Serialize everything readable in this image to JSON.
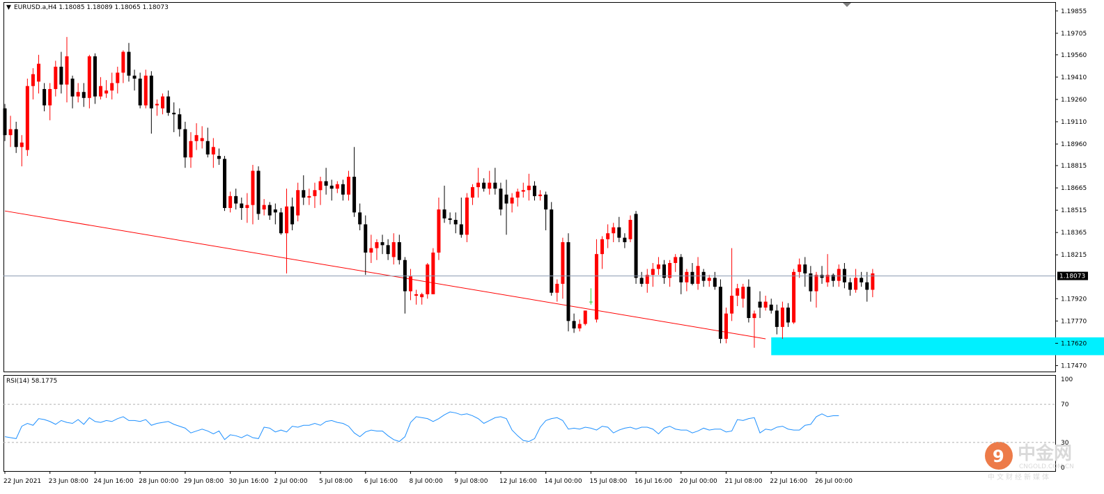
{
  "header": {
    "symbol_line": "EURUSD.a,H4  1.18085 1.18089 1.18065 1.18073",
    "arrow": "▼"
  },
  "colors": {
    "bull": "#ff0000",
    "bear": "#000000",
    "neutral": "#33cc33",
    "rsi_line": "#1e90ff",
    "trendline": "#ff0000",
    "support_zone": "#00f0ff",
    "price_line": "#8a9ab0"
  },
  "rsi": {
    "label": "RSI(14) 58.1775",
    "axis_labels": [
      "100",
      "70",
      "30",
      "0"
    ]
  },
  "watermark": {
    "cn": "中金网",
    "en": "CNGOLD.COM.CN",
    "sub": "中文财经新媒体"
  },
  "chart_data": {
    "type": "candlestick",
    "symbol": "EURUSD.a",
    "timeframe": "H4",
    "last_price": 1.18073,
    "price_axis": {
      "ylim": [
        1.1743,
        1.1991
      ],
      "ticks": [
        "1.19855",
        "1.19705",
        "1.19560",
        "1.19410",
        "1.19260",
        "1.19110",
        "1.18960",
        "1.18815",
        "1.18665",
        "1.18515",
        "1.18365",
        "1.18215",
        "1.18073",
        "1.17920",
        "1.17770",
        "1.17620",
        "1.17470"
      ],
      "current_price_label": "1.18073"
    },
    "time_axis": {
      "labels": [
        "22 Jun 2021",
        "23 Jun 08:00",
        "24 Jun 16:00",
        "28 Jun 00:00",
        "29 Jun 08:00",
        "30 Jun 16:00",
        "2 Jul 00:00",
        "5 Jul 08:00",
        "6 Jul 16:00",
        "8 Jul 00:00",
        "9 Jul 08:00",
        "12 Jul 16:00",
        "14 Jul 00:00",
        "15 Jul 08:00",
        "16 Jul 16:00",
        "20 Jul 00:00",
        "21 Jul 08:00",
        "22 Jul 16:00",
        "26 Jul 00:00"
      ],
      "label_bar_index": [
        0,
        8,
        16,
        24,
        32,
        40,
        48,
        56,
        64,
        72,
        80,
        88,
        96,
        104,
        112,
        120,
        128,
        136,
        144
      ]
    },
    "candles": [
      {
        "o": 1.192,
        "h": 1.1923,
        "l": 1.1898,
        "c": 1.1902
      },
      {
        "o": 1.1902,
        "h": 1.1915,
        "l": 1.1894,
        "c": 1.1906
      },
      {
        "o": 1.1906,
        "h": 1.1911,
        "l": 1.189,
        "c": 1.1894
      },
      {
        "o": 1.1894,
        "h": 1.1902,
        "l": 1.1881,
        "c": 1.1897
      },
      {
        "o": 1.1892,
        "h": 1.194,
        "l": 1.1888,
        "c": 1.1935
      },
      {
        "o": 1.1935,
        "h": 1.1947,
        "l": 1.1926,
        "c": 1.1943
      },
      {
        "o": 1.1938,
        "h": 1.1956,
        "l": 1.193,
        "c": 1.195
      },
      {
        "o": 1.1933,
        "h": 1.1937,
        "l": 1.1918,
        "c": 1.1922
      },
      {
        "o": 1.1922,
        "h": 1.1937,
        "l": 1.1912,
        "c": 1.1933
      },
      {
        "o": 1.1933,
        "h": 1.1952,
        "l": 1.1928,
        "c": 1.1948
      },
      {
        "o": 1.1948,
        "h": 1.1958,
        "l": 1.193,
        "c": 1.1936
      },
      {
        "o": 1.1936,
        "h": 1.1968,
        "l": 1.1924,
        "c": 1.1955
      },
      {
        "o": 1.194,
        "h": 1.1942,
        "l": 1.192,
        "c": 1.1928
      },
      {
        "o": 1.1928,
        "h": 1.1937,
        "l": 1.1924,
        "c": 1.1931
      },
      {
        "o": 1.1931,
        "h": 1.1937,
        "l": 1.1921,
        "c": 1.1927
      },
      {
        "o": 1.1927,
        "h": 1.1956,
        "l": 1.192,
        "c": 1.1955
      },
      {
        "o": 1.1955,
        "h": 1.1957,
        "l": 1.1923,
        "c": 1.1928
      },
      {
        "o": 1.1928,
        "h": 1.1941,
        "l": 1.1926,
        "c": 1.1935
      },
      {
        "o": 1.193,
        "h": 1.1939,
        "l": 1.1927,
        "c": 1.1932
      },
      {
        "o": 1.1932,
        "h": 1.1944,
        "l": 1.1926,
        "c": 1.1937
      },
      {
        "o": 1.1937,
        "h": 1.1948,
        "l": 1.193,
        "c": 1.1944
      },
      {
        "o": 1.1944,
        "h": 1.1959,
        "l": 1.1937,
        "c": 1.1958
      },
      {
        "o": 1.1958,
        "h": 1.1964,
        "l": 1.1938,
        "c": 1.1942
      },
      {
        "o": 1.1942,
        "h": 1.1946,
        "l": 1.1932,
        "c": 1.194
      },
      {
        "o": 1.194,
        "h": 1.1944,
        "l": 1.192,
        "c": 1.1922
      },
      {
        "o": 1.1922,
        "h": 1.1946,
        "l": 1.192,
        "c": 1.1942
      },
      {
        "o": 1.1942,
        "h": 1.1945,
        "l": 1.1903,
        "c": 1.192
      },
      {
        "o": 1.1922,
        "h": 1.1926,
        "l": 1.1915,
        "c": 1.1923
      },
      {
        "o": 1.192,
        "h": 1.193,
        "l": 1.1916,
        "c": 1.1928
      },
      {
        "o": 1.1928,
        "h": 1.1932,
        "l": 1.1915,
        "c": 1.1917
      },
      {
        "o": 1.1917,
        "h": 1.1924,
        "l": 1.1904,
        "c": 1.1916
      },
      {
        "o": 1.1916,
        "h": 1.192,
        "l": 1.1901,
        "c": 1.1906
      },
      {
        "o": 1.1906,
        "h": 1.1911,
        "l": 1.188,
        "c": 1.1887
      },
      {
        "o": 1.1887,
        "h": 1.1904,
        "l": 1.188,
        "c": 1.1898
      },
      {
        "o": 1.1898,
        "h": 1.191,
        "l": 1.1892,
        "c": 1.1902
      },
      {
        "o": 1.1898,
        "h": 1.1908,
        "l": 1.1893,
        "c": 1.19
      },
      {
        "o": 1.1898,
        "h": 1.1907,
        "l": 1.1887,
        "c": 1.1889
      },
      {
        "o": 1.1889,
        "h": 1.19,
        "l": 1.188,
        "c": 1.1894
      },
      {
        "o": 1.1888,
        "h": 1.1893,
        "l": 1.1882,
        "c": 1.1886
      },
      {
        "o": 1.1886,
        "h": 1.1888,
        "l": 1.1851,
        "c": 1.1853
      },
      {
        "o": 1.1853,
        "h": 1.1864,
        "l": 1.185,
        "c": 1.1861
      },
      {
        "o": 1.1861,
        "h": 1.1866,
        "l": 1.1852,
        "c": 1.1856
      },
      {
        "o": 1.1856,
        "h": 1.186,
        "l": 1.1845,
        "c": 1.1853
      },
      {
        "o": 1.1853,
        "h": 1.1863,
        "l": 1.1843,
        "c": 1.1855
      },
      {
        "o": 1.1855,
        "h": 1.1882,
        "l": 1.1842,
        "c": 1.1878
      },
      {
        "o": 1.1878,
        "h": 1.1881,
        "l": 1.1845,
        "c": 1.1849
      },
      {
        "o": 1.1852,
        "h": 1.1859,
        "l": 1.1848,
        "c": 1.1855
      },
      {
        "o": 1.1855,
        "h": 1.1857,
        "l": 1.1845,
        "c": 1.1848
      },
      {
        "o": 1.1852,
        "h": 1.1856,
        "l": 1.1842,
        "c": 1.185
      },
      {
        "o": 1.185,
        "h": 1.1853,
        "l": 1.1835,
        "c": 1.1836
      },
      {
        "o": 1.1836,
        "h": 1.1866,
        "l": 1.1809,
        "c": 1.1854
      },
      {
        "o": 1.1854,
        "h": 1.186,
        "l": 1.1838,
        "c": 1.1842
      },
      {
        "o": 1.1848,
        "h": 1.187,
        "l": 1.1844,
        "c": 1.1865
      },
      {
        "o": 1.1865,
        "h": 1.1875,
        "l": 1.1855,
        "c": 1.186
      },
      {
        "o": 1.186,
        "h": 1.1866,
        "l": 1.1855,
        "c": 1.1861
      },
      {
        "o": 1.1861,
        "h": 1.187,
        "l": 1.1853,
        "c": 1.1865
      },
      {
        "o": 1.1865,
        "h": 1.1874,
        "l": 1.1855,
        "c": 1.1871
      },
      {
        "o": 1.1871,
        "h": 1.188,
        "l": 1.1862,
        "c": 1.1868
      },
      {
        "o": 1.1868,
        "h": 1.1872,
        "l": 1.1858,
        "c": 1.1866
      },
      {
        "o": 1.1866,
        "h": 1.1871,
        "l": 1.1863,
        "c": 1.1869
      },
      {
        "o": 1.1869,
        "h": 1.1872,
        "l": 1.1858,
        "c": 1.1862
      },
      {
        "o": 1.1862,
        "h": 1.1878,
        "l": 1.1858,
        "c": 1.1874
      },
      {
        "o": 1.1874,
        "h": 1.1894,
        "l": 1.1847,
        "c": 1.185
      },
      {
        "o": 1.185,
        "h": 1.1856,
        "l": 1.1838,
        "c": 1.1842
      },
      {
        "o": 1.1842,
        "h": 1.1848,
        "l": 1.1808,
        "c": 1.1823
      },
      {
        "o": 1.1823,
        "h": 1.1835,
        "l": 1.1816,
        "c": 1.1826
      },
      {
        "o": 1.1826,
        "h": 1.1832,
        "l": 1.1818,
        "c": 1.183
      },
      {
        "o": 1.183,
        "h": 1.1835,
        "l": 1.1822,
        "c": 1.1828
      },
      {
        "o": 1.1828,
        "h": 1.1832,
        "l": 1.1818,
        "c": 1.1822
      },
      {
        "o": 1.182,
        "h": 1.1836,
        "l": 1.1815,
        "c": 1.183
      },
      {
        "o": 1.183,
        "h": 1.1835,
        "l": 1.1815,
        "c": 1.1818
      },
      {
        "o": 1.1818,
        "h": 1.182,
        "l": 1.1782,
        "c": 1.1797
      },
      {
        "o": 1.1797,
        "h": 1.1812,
        "l": 1.1791,
        "c": 1.1807
      },
      {
        "o": 1.1794,
        "h": 1.1798,
        "l": 1.1788,
        "c": 1.1795
      },
      {
        "o": 1.1793,
        "h": 1.1796,
        "l": 1.1788,
        "c": 1.1795
      },
      {
        "o": 1.1795,
        "h": 1.1816,
        "l": 1.1792,
        "c": 1.1815
      },
      {
        "o": 1.1795,
        "h": 1.1826,
        "l": 1.1795,
        "c": 1.1823
      },
      {
        "o": 1.1823,
        "h": 1.186,
        "l": 1.1818,
        "c": 1.1852
      },
      {
        "o": 1.1852,
        "h": 1.1868,
        "l": 1.1843,
        "c": 1.1846
      },
      {
        "o": 1.1846,
        "h": 1.185,
        "l": 1.1842,
        "c": 1.1845
      },
      {
        "o": 1.1845,
        "h": 1.185,
        "l": 1.1836,
        "c": 1.1842
      },
      {
        "o": 1.1842,
        "h": 1.186,
        "l": 1.1833,
        "c": 1.1835
      },
      {
        "o": 1.1835,
        "h": 1.1863,
        "l": 1.183,
        "c": 1.186
      },
      {
        "o": 1.186,
        "h": 1.1869,
        "l": 1.1855,
        "c": 1.1867
      },
      {
        "o": 1.1867,
        "h": 1.188,
        "l": 1.186,
        "c": 1.187
      },
      {
        "o": 1.187,
        "h": 1.1873,
        "l": 1.1864,
        "c": 1.1866
      },
      {
        "o": 1.1866,
        "h": 1.1878,
        "l": 1.1862,
        "c": 1.187
      },
      {
        "o": 1.187,
        "h": 1.188,
        "l": 1.1862,
        "c": 1.1866
      },
      {
        "o": 1.1866,
        "h": 1.187,
        "l": 1.1848,
        "c": 1.1852
      },
      {
        "o": 1.1862,
        "h": 1.1872,
        "l": 1.1835,
        "c": 1.1856
      },
      {
        "o": 1.1856,
        "h": 1.1863,
        "l": 1.185,
        "c": 1.186
      },
      {
        "o": 1.186,
        "h": 1.1866,
        "l": 1.1854,
        "c": 1.1864
      },
      {
        "o": 1.1864,
        "h": 1.187,
        "l": 1.186,
        "c": 1.1865
      },
      {
        "o": 1.1865,
        "h": 1.1876,
        "l": 1.1858,
        "c": 1.1868
      },
      {
        "o": 1.1868,
        "h": 1.1871,
        "l": 1.1858,
        "c": 1.1861
      },
      {
        "o": 1.1861,
        "h": 1.1865,
        "l": 1.1858,
        "c": 1.1862
      },
      {
        "o": 1.1862,
        "h": 1.1864,
        "l": 1.1838,
        "c": 1.1852
      },
      {
        "o": 1.1852,
        "h": 1.1857,
        "l": 1.1794,
        "c": 1.1796
      },
      {
        "o": 1.1796,
        "h": 1.1805,
        "l": 1.179,
        "c": 1.1802
      },
      {
        "o": 1.1802,
        "h": 1.1833,
        "l": 1.1792,
        "c": 1.183
      },
      {
        "o": 1.183,
        "h": 1.1836,
        "l": 1.177,
        "c": 1.1777
      },
      {
        "o": 1.1777,
        "h": 1.1782,
        "l": 1.1769,
        "c": 1.1772
      },
      {
        "o": 1.1772,
        "h": 1.1778,
        "l": 1.177,
        "c": 1.1775
      },
      {
        "o": 1.1775,
        "h": 1.1784,
        "l": 1.1774,
        "c": 1.1784
      },
      {
        "o": 1.179,
        "h": 1.1799,
        "l": 1.1788,
        "c": 1.179
      },
      {
        "o": 1.1778,
        "h": 1.1832,
        "l": 1.1776,
        "c": 1.1822
      },
      {
        "o": 1.1822,
        "h": 1.1834,
        "l": 1.1812,
        "c": 1.1832
      },
      {
        "o": 1.1832,
        "h": 1.1842,
        "l": 1.1826,
        "c": 1.1836
      },
      {
        "o": 1.1836,
        "h": 1.1843,
        "l": 1.183,
        "c": 1.184
      },
      {
        "o": 1.184,
        "h": 1.1847,
        "l": 1.183,
        "c": 1.1833
      },
      {
        "o": 1.1833,
        "h": 1.1836,
        "l": 1.1826,
        "c": 1.183
      },
      {
        "o": 1.1832,
        "h": 1.1848,
        "l": 1.183,
        "c": 1.1845
      },
      {
        "o": 1.1849,
        "h": 1.1851,
        "l": 1.1802,
        "c": 1.1806
      },
      {
        "o": 1.1806,
        "h": 1.181,
        "l": 1.18,
        "c": 1.1802
      },
      {
        "o": 1.1802,
        "h": 1.1812,
        "l": 1.1796,
        "c": 1.1808
      },
      {
        "o": 1.1808,
        "h": 1.1816,
        "l": 1.18,
        "c": 1.1812
      },
      {
        "o": 1.1812,
        "h": 1.182,
        "l": 1.1808,
        "c": 1.1815
      },
      {
        "o": 1.1815,
        "h": 1.1818,
        "l": 1.1802,
        "c": 1.1806
      },
      {
        "o": 1.1806,
        "h": 1.1818,
        "l": 1.18,
        "c": 1.1816
      },
      {
        "o": 1.1816,
        "h": 1.1822,
        "l": 1.181,
        "c": 1.182
      },
      {
        "o": 1.182,
        "h": 1.1822,
        "l": 1.1795,
        "c": 1.1803
      },
      {
        "o": 1.1803,
        "h": 1.1812,
        "l": 1.1797,
        "c": 1.181
      },
      {
        "o": 1.181,
        "h": 1.1816,
        "l": 1.1801,
        "c": 1.1802
      },
      {
        "o": 1.1802,
        "h": 1.182,
        "l": 1.1798,
        "c": 1.1814
      },
      {
        "o": 1.181,
        "h": 1.1812,
        "l": 1.18,
        "c": 1.1804
      },
      {
        "o": 1.1804,
        "h": 1.1808,
        "l": 1.18,
        "c": 1.1806
      },
      {
        "o": 1.1806,
        "h": 1.181,
        "l": 1.1798,
        "c": 1.18
      },
      {
        "o": 1.18,
        "h": 1.1805,
        "l": 1.1762,
        "c": 1.1765
      },
      {
        "o": 1.1765,
        "h": 1.1786,
        "l": 1.1762,
        "c": 1.1782
      },
      {
        "o": 1.1782,
        "h": 1.1826,
        "l": 1.1777,
        "c": 1.1794
      },
      {
        "o": 1.1794,
        "h": 1.1802,
        "l": 1.1787,
        "c": 1.1799
      },
      {
        "o": 1.1792,
        "h": 1.1802,
        "l": 1.1786,
        "c": 1.18
      },
      {
        "o": 1.18,
        "h": 1.1805,
        "l": 1.1776,
        "c": 1.1779
      },
      {
        "o": 1.1779,
        "h": 1.1784,
        "l": 1.1759,
        "c": 1.1782
      },
      {
        "o": 1.179,
        "h": 1.1797,
        "l": 1.1779,
        "c": 1.1786
      },
      {
        "o": 1.1786,
        "h": 1.1794,
        "l": 1.1784,
        "c": 1.179
      },
      {
        "o": 1.1788,
        "h": 1.1792,
        "l": 1.1782,
        "c": 1.1784
      },
      {
        "o": 1.1784,
        "h": 1.1788,
        "l": 1.1768,
        "c": 1.1773
      },
      {
        "o": 1.1773,
        "h": 1.179,
        "l": 1.1765,
        "c": 1.1786
      },
      {
        "o": 1.1786,
        "h": 1.1789,
        "l": 1.1773,
        "c": 1.1776
      },
      {
        "o": 1.1776,
        "h": 1.1812,
        "l": 1.1775,
        "c": 1.181
      },
      {
        "o": 1.181,
        "h": 1.1819,
        "l": 1.1806,
        "c": 1.1815
      },
      {
        "o": 1.1815,
        "h": 1.182,
        "l": 1.18,
        "c": 1.1809
      },
      {
        "o": 1.1809,
        "h": 1.1814,
        "l": 1.179,
        "c": 1.1797
      },
      {
        "o": 1.1797,
        "h": 1.181,
        "l": 1.1786,
        "c": 1.1808
      },
      {
        "o": 1.1808,
        "h": 1.1814,
        "l": 1.1802,
        "c": 1.1806
      },
      {
        "o": 1.1803,
        "h": 1.1822,
        "l": 1.18,
        "c": 1.1808
      },
      {
        "o": 1.1808,
        "h": 1.1809,
        "l": 1.18,
        "c": 1.1804
      },
      {
        "o": 1.1804,
        "h": 1.1815,
        "l": 1.18,
        "c": 1.1812
      },
      {
        "o": 1.1812,
        "h": 1.1816,
        "l": 1.1799,
        "c": 1.1803
      },
      {
        "o": 1.1803,
        "h": 1.1806,
        "l": 1.1794,
        "c": 1.1798
      },
      {
        "o": 1.1798,
        "h": 1.1812,
        "l": 1.1796,
        "c": 1.1806
      },
      {
        "o": 1.1806,
        "h": 1.181,
        "l": 1.18,
        "c": 1.1803
      },
      {
        "o": 1.1803,
        "h": 1.181,
        "l": 1.179,
        "c": 1.1798
      },
      {
        "o": 1.1798,
        "h": 1.1812,
        "l": 1.1793,
        "c": 1.1809
      }
    ],
    "trendline": {
      "start_bar": 0,
      "start_price": 1.1851,
      "end_bar": 135,
      "end_price": 1.1765
    },
    "support_zone": {
      "start_bar": 136,
      "end_bar": 215,
      "top": 1.1766,
      "bottom": 1.1754
    },
    "rsi_series": {
      "name": "RSI(14)",
      "last_value": 58.1775,
      "ylim": [
        0,
        100
      ],
      "levels": [
        70,
        30
      ],
      "values": [
        36,
        35,
        34,
        47,
        50,
        48,
        55,
        54,
        52,
        49,
        53,
        51,
        50,
        54,
        49,
        56,
        52,
        51,
        53,
        52,
        55,
        57,
        53,
        53,
        52,
        54,
        48,
        50,
        51,
        52,
        49,
        47,
        45,
        40,
        42,
        44,
        42,
        39,
        42,
        33,
        38,
        37,
        35,
        38,
        35,
        34,
        46,
        45,
        41,
        43,
        41,
        47,
        46,
        48,
        48,
        50,
        48,
        52,
        53,
        51,
        50,
        47,
        40,
        36,
        41,
        43,
        42,
        42,
        37,
        33,
        31,
        36,
        51,
        57,
        56,
        55,
        52,
        55,
        59,
        62,
        61,
        59,
        60,
        58,
        55,
        50,
        53,
        56,
        57,
        55,
        43,
        37,
        32,
        31,
        34,
        46,
        53,
        55,
        56,
        53,
        44,
        45,
        44,
        46,
        45,
        43,
        47,
        46,
        40,
        43,
        45,
        46,
        44,
        46,
        46,
        44,
        39,
        45,
        47,
        44,
        43,
        43,
        40,
        42,
        45,
        43,
        44,
        44,
        41,
        42,
        54,
        53,
        55,
        56,
        40,
        44,
        43,
        46,
        47,
        44,
        43,
        43,
        48,
        49,
        57,
        60,
        57,
        58,
        58
      ]
    }
  }
}
